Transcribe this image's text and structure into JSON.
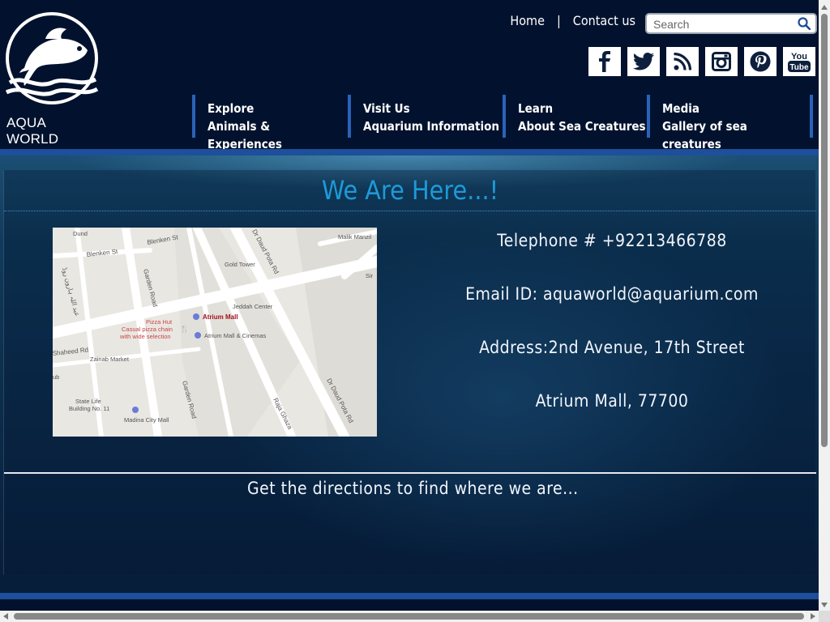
{
  "brand": {
    "logo_text": "AQUA WORLD"
  },
  "top_links": {
    "home": "Home",
    "separator": "|",
    "contact": "Contact us"
  },
  "search": {
    "placeholder": "Search",
    "value": ""
  },
  "socials": [
    "facebook-icon",
    "twitter-icon",
    "rss-icon",
    "instagram-icon",
    "pinterest-icon",
    "youtube-icon"
  ],
  "youtube_label": {
    "top": "You",
    "bottom": "Tube"
  },
  "nav": [
    {
      "title": "Explore",
      "subtitle": "Animals & Experiences"
    },
    {
      "title": "Visit Us",
      "subtitle": "Aquarium Information"
    },
    {
      "title": "Learn",
      "subtitle": "About Sea Creatures"
    },
    {
      "title": "Media",
      "subtitle": "Gallery of sea creatures"
    }
  ],
  "main": {
    "title": "We Are Here...!",
    "contact": {
      "telephone": "Telephone # +92213466788",
      "email": "Email ID: aquaworld@aquarium.com",
      "address": "Address:2nd Avenue, 17th Street",
      "address2": "Atrium Mall, 77700"
    },
    "directions": "Get the directions to find where we are..."
  },
  "map": {
    "labels": {
      "malik_manzil": "Malik Manzil",
      "gold_tower": "Gold Tower",
      "jeddah_center": "Jeddah Center",
      "atrium_mall": "Atrium Mall",
      "atrium_cinemas": "Atrium Mall & Cinemas",
      "pizza_hut": "Pizza Hut",
      "pizza_desc1": "Casual pizza chain",
      "pizza_desc2": "with wide selection",
      "zainab_market": "Zainab Market",
      "state_life1": "State Life",
      "state_life2": "Building No. 11",
      "madina_city": "Madina City Mall",
      "garden_road1": "Garden Road",
      "garden_road2": "Garden Road",
      "daud_pota1": "Dr Daud Pota Rd",
      "daud_pota2": "Dr Daud Pota Rd",
      "raja_ghazanfar": "Raja Ghaza",
      "blenken1": "Blenken St",
      "blenken2": "Blenken St",
      "shaheed_rd": "Shaheed Rd",
      "urdu_road": "عبد اللہ ہارون روڈ",
      "dundas": "Dund",
      "sir": "Sir",
      "hub": "ub"
    }
  },
  "colors": {
    "header_bg": "#02122e",
    "accent_blue": "#1d4f9b",
    "title_blue": "#1d9ad8"
  }
}
